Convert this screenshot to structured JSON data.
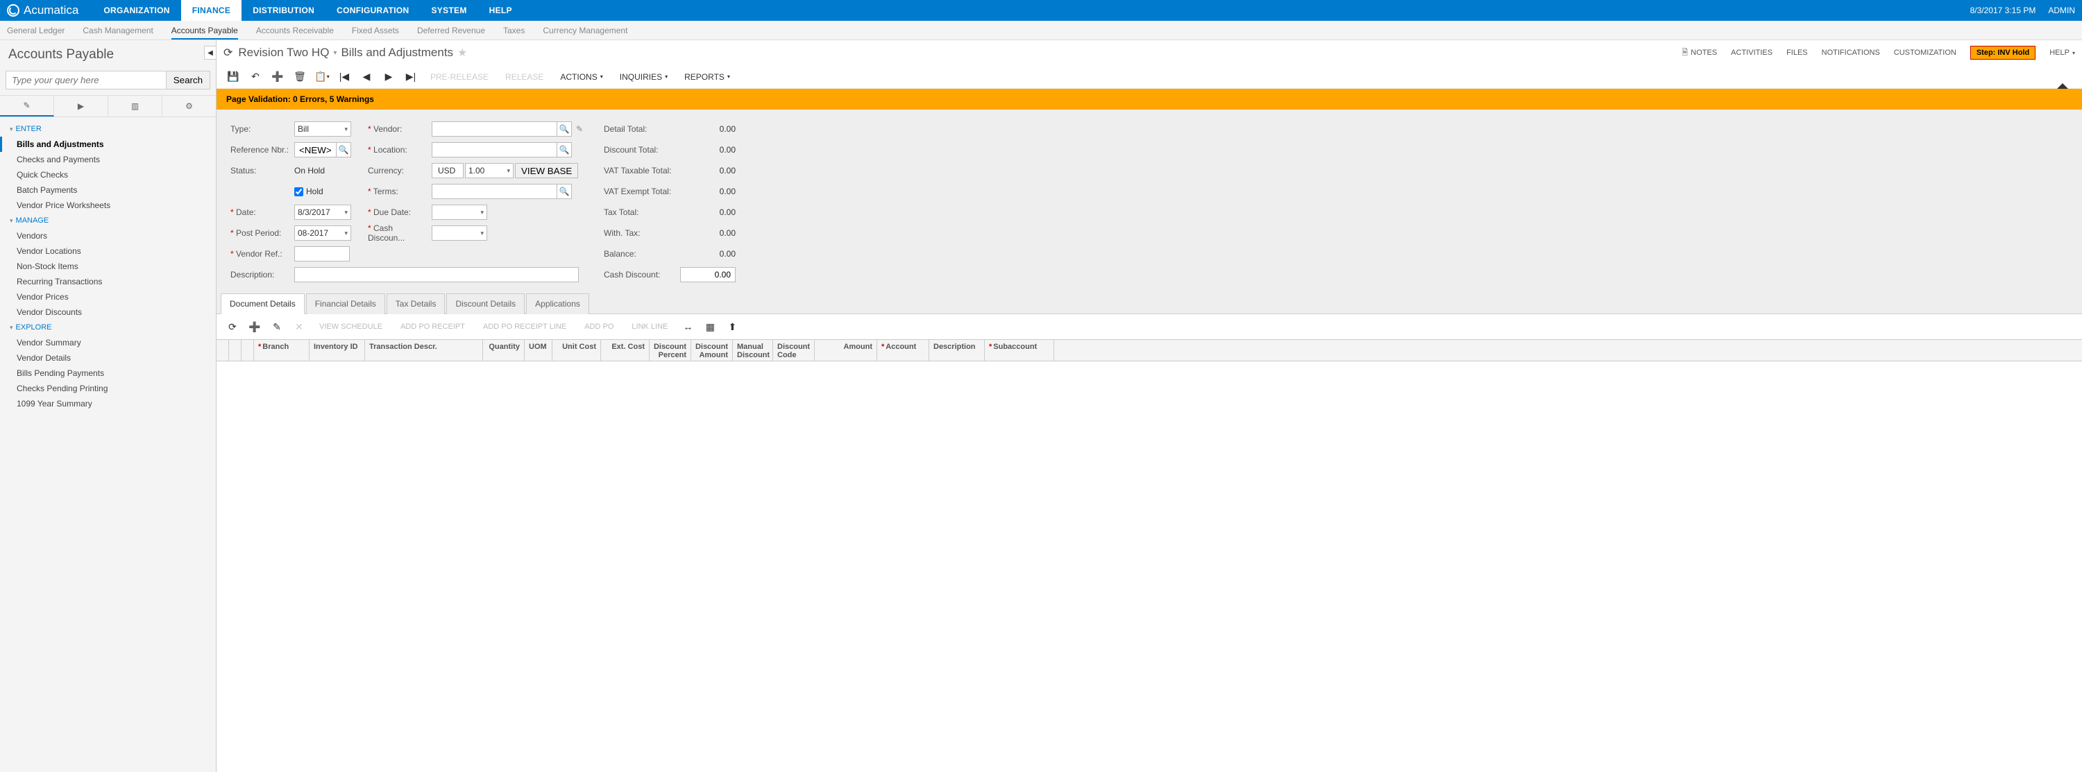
{
  "app": "Acumatica",
  "datetime": "8/3/2017  3:15 PM",
  "user": "ADMIN",
  "main_tabs": [
    "ORGANIZATION",
    "FINANCE",
    "DISTRIBUTION",
    "CONFIGURATION",
    "SYSTEM",
    "HELP"
  ],
  "main_tab_active": 1,
  "sub_tabs": [
    "General Ledger",
    "Cash Management",
    "Accounts Payable",
    "Accounts Receivable",
    "Fixed Assets",
    "Deferred Revenue",
    "Taxes",
    "Currency Management"
  ],
  "sub_tab_active": 2,
  "sidebar": {
    "title": "Accounts Payable",
    "search_placeholder": "Type your query here",
    "search_button": "Search",
    "sections": [
      {
        "label": "ENTER",
        "items": [
          "Bills and Adjustments",
          "Checks and Payments",
          "Quick Checks",
          "Batch Payments",
          "Vendor Price Worksheets"
        ],
        "active": 0
      },
      {
        "label": "MANAGE",
        "items": [
          "Vendors",
          "Vendor Locations",
          "Non-Stock Items",
          "Recurring Transactions",
          "Vendor Prices",
          "Vendor Discounts"
        ]
      },
      {
        "label": "EXPLORE",
        "items": [
          "Vendor Summary",
          "Vendor Details",
          "Bills Pending Payments",
          "Checks Pending Printing",
          "1099 Year Summary"
        ]
      }
    ]
  },
  "breadcrumb": {
    "org": "Revision Two HQ",
    "screen": "Bills and Adjustments"
  },
  "header_actions": {
    "notes": "NOTES",
    "activities": "ACTIVITIES",
    "files": "FILES",
    "notifications": "NOTIFICATIONS",
    "customization": "CUSTOMIZATION",
    "step": "Step: INV Hold",
    "help": "HELP"
  },
  "toolbar": {
    "prerelease": "PRE-RELEASE",
    "release": "RELEASE",
    "actions": "ACTIONS",
    "inquiries": "INQUIRIES",
    "reports": "REPORTS"
  },
  "validation": "Page Validation: 0 Errors, 5 Warnings",
  "form": {
    "labels": {
      "type": "Type:",
      "ref": "Reference Nbr.:",
      "status": "Status:",
      "hold": "Hold",
      "date": "Date:",
      "post_period": "Post Period:",
      "vendor_ref": "Vendor Ref.:",
      "description": "Description:",
      "vendor": "Vendor:",
      "location": "Location:",
      "currency": "Currency:",
      "terms": "Terms:",
      "due_date": "Due Date:",
      "cash_discount": "Cash Discoun...",
      "view_base": "VIEW BASE",
      "detail_total": "Detail Total:",
      "discount_total": "Discount Total:",
      "vat_taxable": "VAT Taxable Total:",
      "vat_exempt": "VAT Exempt Total:",
      "tax_total": "Tax Total:",
      "with_tax": "With. Tax:",
      "balance": "Balance:",
      "cash_disc": "Cash Discount:"
    },
    "values": {
      "type": "Bill",
      "ref": "<NEW>",
      "status": "On Hold",
      "hold": true,
      "date": "8/3/2017",
      "post_period": "08-2017",
      "vendor_ref": "",
      "description": "",
      "currency": "USD",
      "rate": "1.00",
      "detail_total": "0.00",
      "discount_total": "0.00",
      "vat_taxable": "0.00",
      "vat_exempt": "0.00",
      "tax_total": "0.00",
      "with_tax": "0.00",
      "balance": "0.00",
      "cash_disc": "0.00"
    }
  },
  "doc_tabs": [
    "Document Details",
    "Financial Details",
    "Tax Details",
    "Discount Details",
    "Applications"
  ],
  "doc_tab_active": 0,
  "grid_toolbar": {
    "view_schedule": "VIEW SCHEDULE",
    "add_po_receipt": "ADD PO RECEIPT",
    "add_po_receipt_line": "ADD PO RECEIPT LINE",
    "add_po": "ADD PO",
    "link_line": "LINK LINE"
  },
  "grid_cols": [
    {
      "label": "",
      "w": 18
    },
    {
      "label": "",
      "w": 18
    },
    {
      "label": "",
      "w": 18
    },
    {
      "label": "Branch",
      "w": 80,
      "req": true
    },
    {
      "label": "Inventory ID",
      "w": 80
    },
    {
      "label": "Transaction Descr.",
      "w": 170
    },
    {
      "label": "Quantity",
      "w": 60,
      "num": true
    },
    {
      "label": "UOM",
      "w": 40
    },
    {
      "label": "Unit Cost",
      "w": 70,
      "num": true
    },
    {
      "label": "Ext. Cost",
      "w": 70,
      "num": true
    },
    {
      "label": "Discount Percent",
      "w": 60,
      "num": true
    },
    {
      "label": "Discount Amount",
      "w": 60,
      "num": true
    },
    {
      "label": "Manual Discount",
      "w": 58
    },
    {
      "label": "Discount Code",
      "w": 60
    },
    {
      "label": "Amount",
      "w": 90,
      "num": true
    },
    {
      "label": "Account",
      "w": 75,
      "req": true
    },
    {
      "label": "Description",
      "w": 80
    },
    {
      "label": "Subaccount",
      "w": 100,
      "req": true
    }
  ]
}
